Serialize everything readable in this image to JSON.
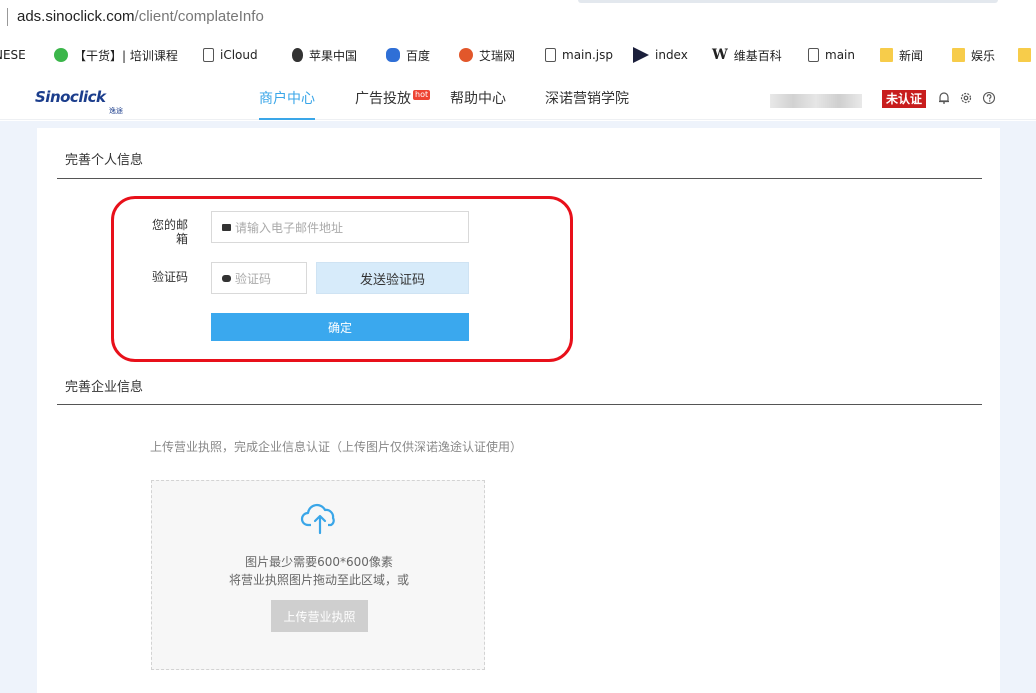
{
  "browser": {
    "url_host": "ads.sinoclick.com",
    "url_path": "/client/complateInfo",
    "bookmarks": [
      {
        "label": "NESE",
        "icon": "none"
      },
      {
        "label": "【干货】| 培训课程",
        "icon": "wechat-icon"
      },
      {
        "label": "iCloud",
        "icon": "page-icon"
      },
      {
        "label": "苹果中国",
        "icon": "apple-icon"
      },
      {
        "label": "百度",
        "icon": "baidu-paw-icon"
      },
      {
        "label": "艾瑞网",
        "icon": "iresearch-icon"
      },
      {
        "label": "main.jsp",
        "icon": "page-icon"
      },
      {
        "label": "index",
        "icon": "arrow-icon"
      },
      {
        "label": "维基百科",
        "icon": "wikipedia-icon"
      },
      {
        "label": "main",
        "icon": "page-icon"
      },
      {
        "label": "新闻",
        "icon": "folder-icon"
      },
      {
        "label": "娱乐",
        "icon": "folder-icon"
      }
    ]
  },
  "header": {
    "logo_text": "Sinoclick",
    "logo_sub": "逸途",
    "nav": [
      {
        "label": "商户中心",
        "active": true
      },
      {
        "label": "广告投放",
        "badge": "hot"
      },
      {
        "label": "帮助中心"
      },
      {
        "label": "深诺营销学院"
      }
    ],
    "status_badge": "未认证",
    "icons": [
      "bell-icon",
      "settings-icon",
      "help-icon"
    ]
  },
  "personal": {
    "title": "完善个人信息",
    "email_label": "您的邮箱",
    "email_placeholder": "请输入电子邮件地址",
    "code_label": "验证码",
    "code_placeholder": "验证码",
    "send_button": "发送验证码",
    "confirm_button": "确定"
  },
  "company": {
    "title": "完善企业信息",
    "hint": "上传营业执照，完成企业信息认证（上传图片仅供深诺逸途认证使用）",
    "upload_line1": "图片最少需要600*600像素",
    "upload_line2": "将营业执照图片拖动至此区域，或",
    "upload_button": "上传营业执照"
  },
  "colors": {
    "accent": "#3aa6e8",
    "annotation_red": "#e8101a",
    "unverified_red": "#c81d1d"
  }
}
